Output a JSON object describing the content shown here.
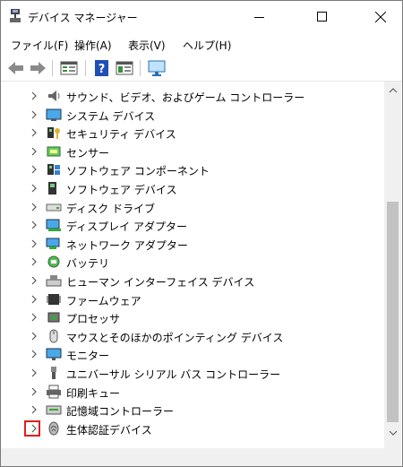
{
  "window": {
    "title": "デバイス マネージャー"
  },
  "menu": [
    "ファイル(F)",
    "操作(A)",
    "表示(V)",
    "ヘルプ(H)"
  ],
  "toolbar": [
    "back-icon",
    "forward-icon",
    "properties-icon",
    "help-icon",
    "view-icon",
    "monitor-icon"
  ],
  "tree": [
    {
      "label": "サウンド、ビデオ、およびゲーム コントローラー",
      "icon": "speaker-icon"
    },
    {
      "label": "システム デバイス",
      "icon": "system-device-icon"
    },
    {
      "label": "セキュリティ デバイス",
      "icon": "security-device-icon"
    },
    {
      "label": "センサー",
      "icon": "sensor-icon"
    },
    {
      "label": "ソフトウェア コンポーネント",
      "icon": "software-component-icon"
    },
    {
      "label": "ソフトウェア デバイス",
      "icon": "software-device-icon"
    },
    {
      "label": "ディスク ドライブ",
      "icon": "disk-drive-icon"
    },
    {
      "label": "ディスプレイ アダプター",
      "icon": "display-adapter-icon"
    },
    {
      "label": "ネットワーク アダプター",
      "icon": "network-adapter-icon"
    },
    {
      "label": "バッテリ",
      "icon": "battery-icon"
    },
    {
      "label": "ヒューマン インターフェイス デバイス",
      "icon": "hid-icon"
    },
    {
      "label": "ファームウェア",
      "icon": "firmware-icon"
    },
    {
      "label": "プロセッサ",
      "icon": "processor-icon"
    },
    {
      "label": "マウスとそのほかのポインティング デバイス",
      "icon": "mouse-icon"
    },
    {
      "label": "モニター",
      "icon": "monitor-icon"
    },
    {
      "label": "ユニバーサル シリアル バス コントローラー",
      "icon": "usb-icon"
    },
    {
      "label": "印刷キュー",
      "icon": "printer-icon"
    },
    {
      "label": "記憶域コントローラー",
      "icon": "storage-controller-icon"
    },
    {
      "label": "生体認証デバイス",
      "icon": "biometric-icon"
    }
  ],
  "colors": {
    "highlight": "#e01e1e",
    "scroll_thumb": "#c2c2c2"
  }
}
